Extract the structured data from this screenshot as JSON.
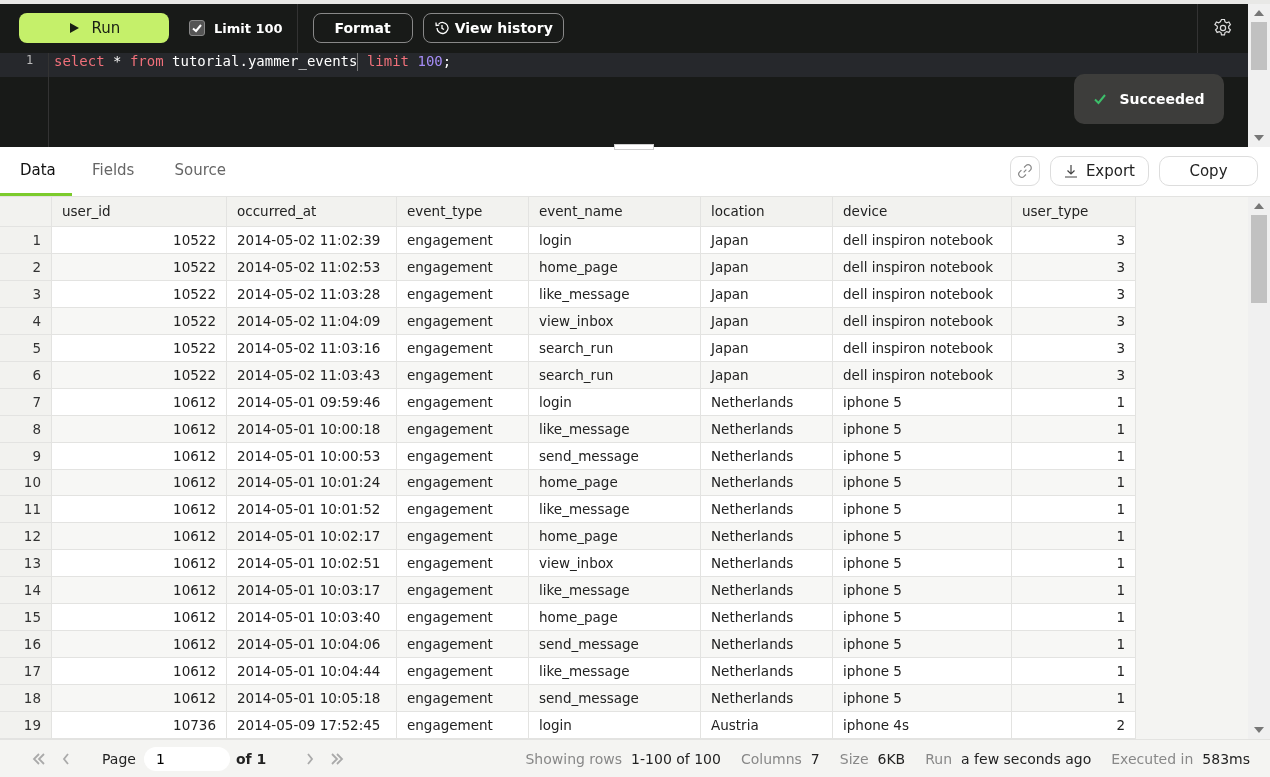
{
  "toolbar": {
    "run": "Run",
    "limit": {
      "label": "Limit 100",
      "checked": true
    },
    "format": "Format",
    "history": "View history"
  },
  "editor": {
    "lines": [
      {
        "number": "1",
        "tokens": [
          {
            "kind": "keyword",
            "text": "select"
          },
          {
            "kind": "plain",
            "text": " * "
          },
          {
            "kind": "keyword",
            "text": "from"
          },
          {
            "kind": "plain",
            "text": " tutorial.yammer_events"
          },
          {
            "kind": "cursor"
          },
          {
            "kind": "keyword",
            "text": " limit"
          },
          {
            "kind": "number",
            "text": " 100"
          },
          {
            "kind": "plain",
            "text": ";"
          }
        ]
      }
    ]
  },
  "toast": {
    "text": "Succeeded"
  },
  "tabs": [
    {
      "label": "Data",
      "selected": true
    },
    {
      "label": "Fields",
      "selected": false
    },
    {
      "label": "Source",
      "selected": false
    }
  ],
  "actions": {
    "export": "Export",
    "copy": "Copy"
  },
  "table": {
    "columns": [
      "user_id",
      "occurred_at",
      "event_type",
      "event_name",
      "location",
      "device",
      "user_type"
    ],
    "rows": [
      {
        "num": "1",
        "cells": [
          "10522",
          "2014-05-02 11:02:39",
          "engagement",
          "login",
          "Japan",
          "dell inspiron notebook",
          "3"
        ]
      },
      {
        "num": "2",
        "cells": [
          "10522",
          "2014-05-02 11:02:53",
          "engagement",
          "home_page",
          "Japan",
          "dell inspiron notebook",
          "3"
        ]
      },
      {
        "num": "3",
        "cells": [
          "10522",
          "2014-05-02 11:03:28",
          "engagement",
          "like_message",
          "Japan",
          "dell inspiron notebook",
          "3"
        ]
      },
      {
        "num": "4",
        "cells": [
          "10522",
          "2014-05-02 11:04:09",
          "engagement",
          "view_inbox",
          "Japan",
          "dell inspiron notebook",
          "3"
        ]
      },
      {
        "num": "5",
        "cells": [
          "10522",
          "2014-05-02 11:03:16",
          "engagement",
          "search_run",
          "Japan",
          "dell inspiron notebook",
          "3"
        ]
      },
      {
        "num": "6",
        "cells": [
          "10522",
          "2014-05-02 11:03:43",
          "engagement",
          "search_run",
          "Japan",
          "dell inspiron notebook",
          "3"
        ]
      },
      {
        "num": "7",
        "cells": [
          "10612",
          "2014-05-01 09:59:46",
          "engagement",
          "login",
          "Netherlands",
          "iphone 5",
          "1"
        ]
      },
      {
        "num": "8",
        "cells": [
          "10612",
          "2014-05-01 10:00:18",
          "engagement",
          "like_message",
          "Netherlands",
          "iphone 5",
          "1"
        ]
      },
      {
        "num": "9",
        "cells": [
          "10612",
          "2014-05-01 10:00:53",
          "engagement",
          "send_message",
          "Netherlands",
          "iphone 5",
          "1"
        ]
      },
      {
        "num": "10",
        "cells": [
          "10612",
          "2014-05-01 10:01:24",
          "engagement",
          "home_page",
          "Netherlands",
          "iphone 5",
          "1"
        ]
      },
      {
        "num": "11",
        "cells": [
          "10612",
          "2014-05-01 10:01:52",
          "engagement",
          "like_message",
          "Netherlands",
          "iphone 5",
          "1"
        ]
      },
      {
        "num": "12",
        "cells": [
          "10612",
          "2014-05-01 10:02:17",
          "engagement",
          "home_page",
          "Netherlands",
          "iphone 5",
          "1"
        ]
      },
      {
        "num": "13",
        "cells": [
          "10612",
          "2014-05-01 10:02:51",
          "engagement",
          "view_inbox",
          "Netherlands",
          "iphone 5",
          "1"
        ]
      },
      {
        "num": "14",
        "cells": [
          "10612",
          "2014-05-01 10:03:17",
          "engagement",
          "like_message",
          "Netherlands",
          "iphone 5",
          "1"
        ]
      },
      {
        "num": "15",
        "cells": [
          "10612",
          "2014-05-01 10:03:40",
          "engagement",
          "home_page",
          "Netherlands",
          "iphone 5",
          "1"
        ]
      },
      {
        "num": "16",
        "cells": [
          "10612",
          "2014-05-01 10:04:06",
          "engagement",
          "send_message",
          "Netherlands",
          "iphone 5",
          "1"
        ]
      },
      {
        "num": "17",
        "cells": [
          "10612",
          "2014-05-01 10:04:44",
          "engagement",
          "like_message",
          "Netherlands",
          "iphone 5",
          "1"
        ]
      },
      {
        "num": "18",
        "cells": [
          "10612",
          "2014-05-01 10:05:18",
          "engagement",
          "send_message",
          "Netherlands",
          "iphone 5",
          "1"
        ]
      },
      {
        "num": "19",
        "cells": [
          "10736",
          "2014-05-09 17:52:45",
          "engagement",
          "login",
          "Austria",
          "iphone 4s",
          "2"
        ]
      }
    ]
  },
  "footer": {
    "page_label": "Page",
    "page_value": "1",
    "of": "of 1",
    "stats": [
      {
        "label": "Showing rows",
        "value": "1-100 of 100"
      },
      {
        "label": "Columns",
        "value": "7"
      },
      {
        "label": "Size",
        "value": "6KB"
      },
      {
        "label": "Run",
        "value": "a few seconds ago"
      },
      {
        "label": "Executed in",
        "value": "583ms"
      }
    ]
  }
}
